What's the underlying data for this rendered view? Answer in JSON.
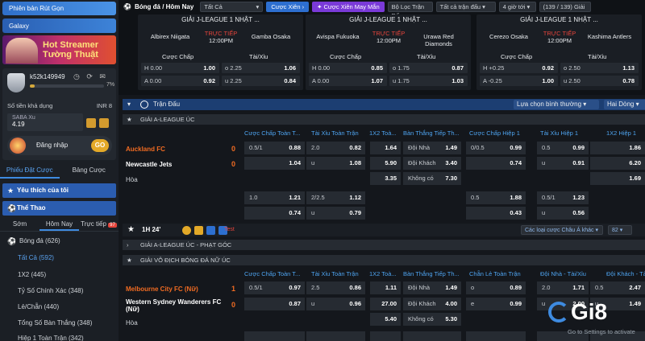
{
  "sidebar": {
    "banner_top": "Phiên bản Rút Gọn",
    "banner_galaxy": "Galaxy",
    "banner_stream": [
      "Hot Streamer",
      "Tường Thuật"
    ],
    "account": {
      "username": "k52k149949",
      "progress_pct": 7,
      "progress_label": "7%",
      "balance_label": "Số tiền khả dụng",
      "currency": "INR 8",
      "wallet_name": "SABA Xu",
      "wallet_value": "4.19",
      "login_label": "Đăng nhập",
      "go_label": "GO"
    },
    "tabs": [
      "Phiếu Đặt Cược",
      "Bảng Cược"
    ],
    "favorites": "Yêu thích của tôi",
    "sports": "Thể Thao",
    "day_tabs": [
      "Sớm",
      "Hôm Nay",
      "Trực tiếp"
    ],
    "live_count": "97",
    "items": [
      {
        "label": "Bóng đá",
        "count": "(626)"
      },
      {
        "label": "Tất Cả",
        "count": "(592)"
      },
      {
        "label": "1X2",
        "count": "(445)"
      },
      {
        "label": "Tỷ Số Chính Xác",
        "count": "(348)"
      },
      {
        "label": "Lẻ/Chẵn",
        "count": "(440)"
      },
      {
        "label": "Tổng Số Bàn Thắng",
        "count": "(348)"
      },
      {
        "label": "Hiệp 1 Toàn Trận",
        "count": "(342)"
      }
    ]
  },
  "toolbar": {
    "title": "Bóng đá / Hôm Nay",
    "select_all": "Tất Cả",
    "parlay": "Cược Xiên",
    "lucky_parlay": "Cược Xiên May Mắn",
    "filter": "Bộ Lọc Trận Đấu",
    "all_matches": "Tất cả trận đấu",
    "hours": "4 giờ tới",
    "pages": "(139 / 139) Giải"
  },
  "cards": [
    {
      "league": "GIẢI J-LEAGUE 1 NHẬT ...",
      "home": "Albirex Niigata",
      "away": "Gamba Osaka",
      "live": "TRỰC TIẾP",
      "time": "12:00PM",
      "hdp": "Cược Chấp",
      "ou": "Tài/Xỉu",
      "rows": [
        [
          "H 0.00",
          "1.00",
          "o 2.25",
          "1.06"
        ],
        [
          "A 0.00",
          "0.92",
          "u 2.25",
          "0.84"
        ]
      ]
    },
    {
      "league": "GIẢI J-LEAGUE 1 NHẬT ...",
      "home": "Avispa Fukuoka",
      "away": "Urawa Red Diamonds",
      "live": "TRỰC TIẾP",
      "time": "12:00PM",
      "hdp": "Cược Chấp",
      "ou": "Tài/Xỉu",
      "rows": [
        [
          "H 0.00",
          "0.85",
          "o 1.75",
          "0.87"
        ],
        [
          "A 0.00",
          "1.07",
          "u 1.75",
          "1.03"
        ]
      ]
    },
    {
      "league": "GIẢI J-LEAGUE 1 NHẬT ...",
      "home": "Cerezo Osaka",
      "away": "Kashima Antlers",
      "live": "TRỰC TIẾP",
      "time": "12:00PM",
      "hdp": "Cược Chấp",
      "ou": "Tài/Xỉu",
      "rows": [
        [
          "H +0.25",
          "0.92",
          "o 2.50",
          "1.13"
        ],
        [
          "A -0.25",
          "1.00",
          "u 2.50",
          "0.78"
        ]
      ]
    }
  ],
  "main": {
    "header": "Trận Đấu",
    "sort": "Lựa chọn bình thường",
    "view": "Hai Dòng",
    "league1": "GIẢI A-LEAGUE ÚC",
    "cols1": [
      "Cược Chấp Toàn T...",
      "Tài Xỉu Toàn Trận",
      "1X2 Toà...",
      "Bàn Thắng Tiếp Th...",
      "Cược Chấp Hiệp 1",
      "Tài Xỉu Hiệp 1",
      "1X2 Hiệp 1"
    ],
    "match1": {
      "home": "Auckland FC",
      "away": "Newcastle Jets",
      "draw": "Hòa",
      "home_score": "0",
      "away_score": "0"
    },
    "live_min": "1H 24'",
    "test": "Test",
    "odds_select": "Các loại cược Châu Á khác",
    "more": "82",
    "league2": "GIẢI A-LEAGUE ÚC - PHẠT GÓC",
    "league3": "GIẢI VÔ ĐỊCH BÓNG ĐÁ NỮ ÚC",
    "cols3": [
      "Cược Chấp Toàn T...",
      "Tài Xỉu Toàn Trận",
      "1X2 Toà...",
      "Bàn Thắng Tiếp Th...",
      "Chẵn Lẻ Toàn Trận",
      "Đội Nhà - Tài/Xỉu",
      "Đội Khách - Tài/Xỉu"
    ],
    "match2": {
      "home": "Melbourne City FC (Nữ)",
      "away": "Western Sydney Wanderers FC (Nữ)",
      "draw": "Hòa",
      "home_score": "1",
      "away_score": "0"
    }
  },
  "watermark": {
    "brand": "Gi8",
    "sub": "Go to Settings to activate"
  }
}
